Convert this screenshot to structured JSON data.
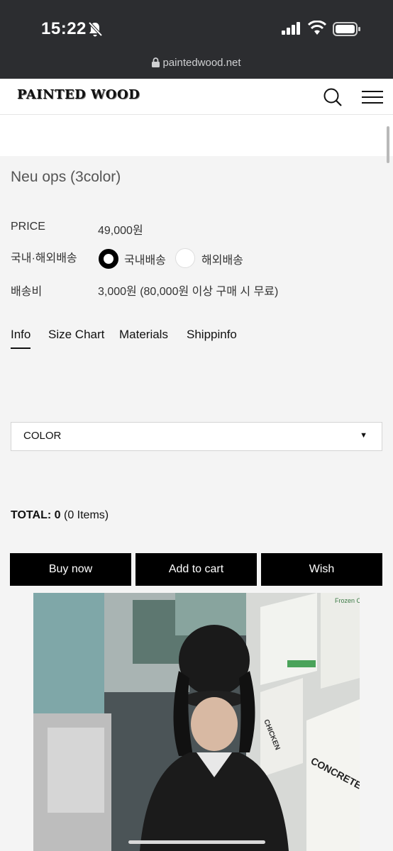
{
  "status_bar": {
    "time": "15:22",
    "url": "paintedwood.net"
  },
  "header": {
    "logo": "PAINTED WOOD"
  },
  "product": {
    "title": "Neu ops (3color)",
    "price_label": "PRICE",
    "price_value": "49,000원",
    "shipping_type_label": "국내·해외배송",
    "shipping_options": [
      "국내배송",
      "해외배송"
    ],
    "shipping_selected": "국내배송",
    "shipping_fee_label": "배송비",
    "shipping_fee_value": "3,000원 (80,000원 이상 구매 시 무료)"
  },
  "tabs": [
    "Info",
    "Size Chart",
    "Materials",
    "Shippinfo"
  ],
  "active_tab": "Info",
  "option_select": {
    "label": "COLOR"
  },
  "total": {
    "label": "TOTAL:",
    "amount": "0",
    "items": "(0 Items)"
  },
  "buttons": {
    "buy_now": "Buy now",
    "add_to_cart": "Add to cart",
    "wish": "Wish"
  },
  "photo_text": {
    "sign": "CONCRETES",
    "sign2": "CHICKEN",
    "sign3": "Frozen Custa"
  },
  "colors": {
    "status_bg": "#2c2d30",
    "button_bg": "#000000",
    "page_bg": "#f4f4f4"
  }
}
